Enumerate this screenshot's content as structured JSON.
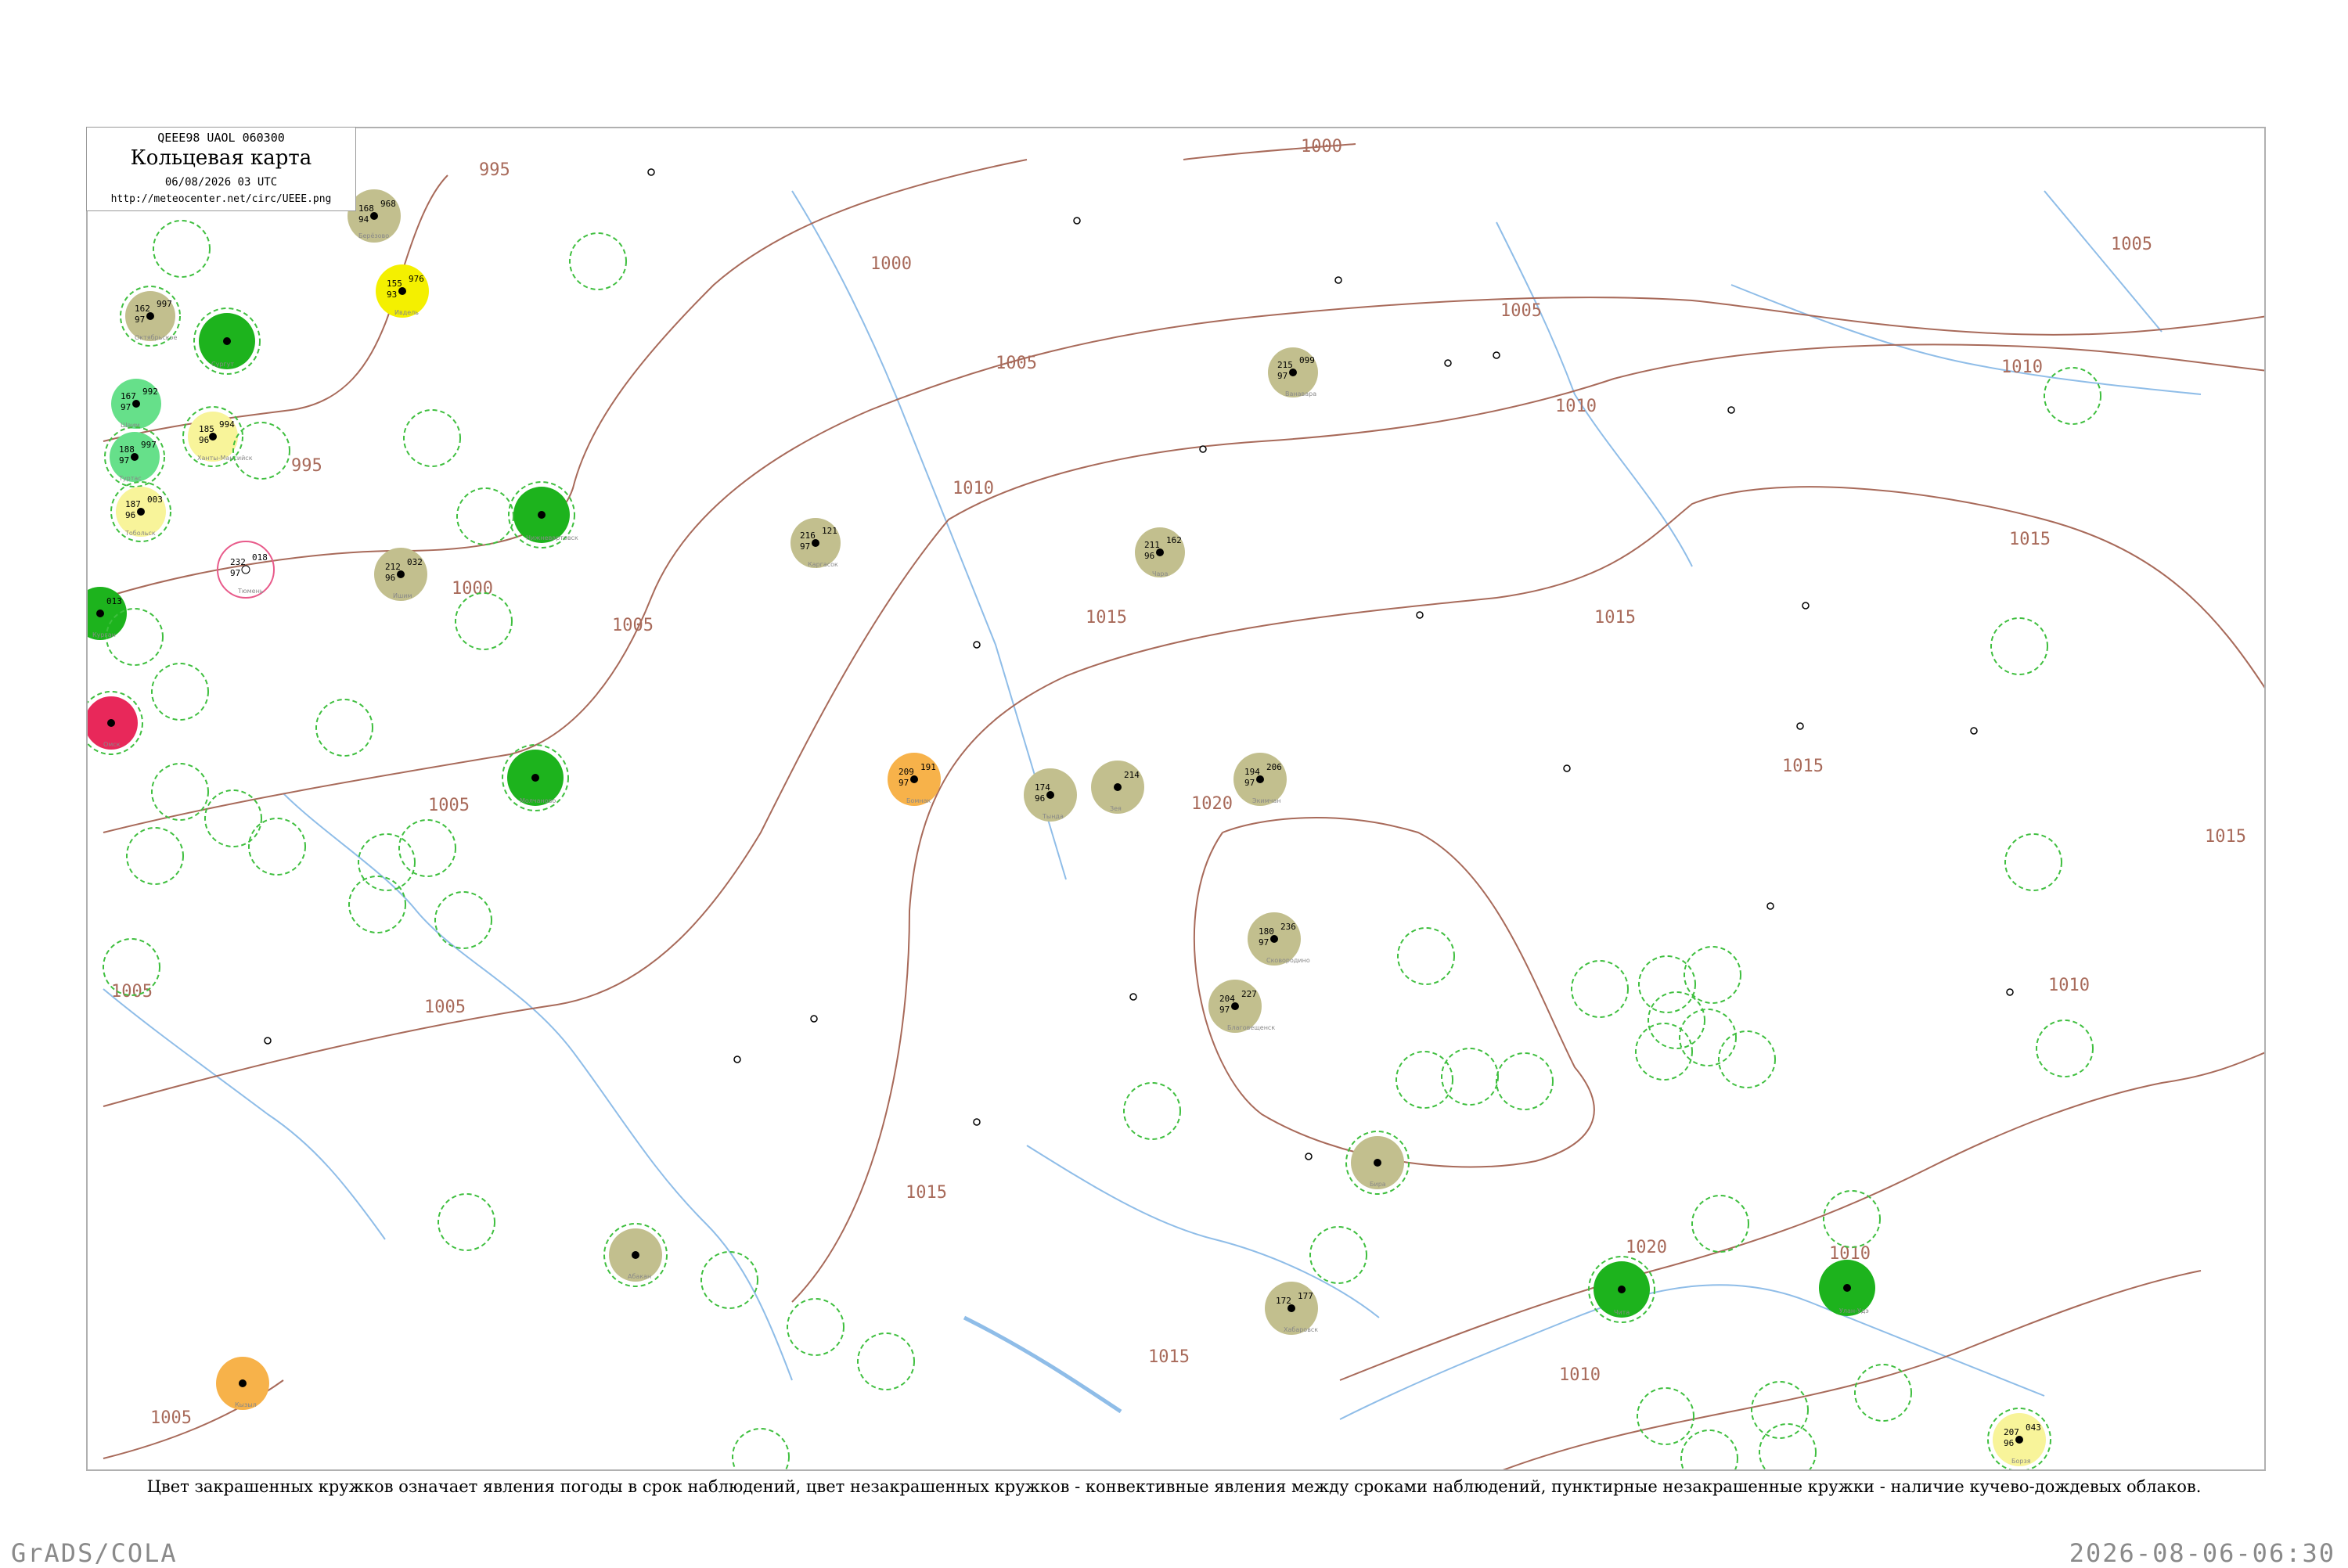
{
  "header": {
    "code": "QEEE98  UAOL  060300",
    "title": "Кольцевая карта",
    "date": "06/08/2026 03 UTC",
    "url": "http://meteocenter.net/circ/UEEE.png"
  },
  "caption": "Цвет закрашенных кружков означает явления погоды в срок наблюдений, цвет незакрашенных кружков - конвективные явления между сроками наблюдений, пунктирные незакрашенные кружки - наличие кучево-дождевых облаков.",
  "footer": {
    "left": "GrADS/COLA",
    "right": "2026-08-06-06:30"
  },
  "colors": {
    "isobar": "#a86a5a",
    "river": "#8fbde8",
    "cb_dashed": "#3fbf3f",
    "fill_olive": "#c2bf8e",
    "fill_green": "#1db31d",
    "fill_lightgreen": "#66e08a",
    "fill_yellow": "#f4f000",
    "fill_paleyellow": "#f8f49a",
    "fill_orange": "#f7b24a",
    "fill_red": "#e8285a",
    "ring_pink": "#e85a8a"
  },
  "isobar_labels": [
    {
      "text": "995"
    },
    {
      "text": "995"
    },
    {
      "text": "1000"
    },
    {
      "text": "1000"
    },
    {
      "text": "1000"
    },
    {
      "text": "1005"
    },
    {
      "text": "1005"
    },
    {
      "text": "1005"
    },
    {
      "text": "1005"
    },
    {
      "text": "1005"
    },
    {
      "text": "1005"
    },
    {
      "text": "1005"
    },
    {
      "text": "1005"
    },
    {
      "text": "1010"
    },
    {
      "text": "1010"
    },
    {
      "text": "1010"
    },
    {
      "text": "1010"
    },
    {
      "text": "1010"
    },
    {
      "text": "1010"
    },
    {
      "text": "1015"
    },
    {
      "text": "1015"
    },
    {
      "text": "1015"
    },
    {
      "text": "1015"
    },
    {
      "text": "1015"
    },
    {
      "text": "1015"
    },
    {
      "text": "1015"
    },
    {
      "text": "1020"
    },
    {
      "text": "1020"
    }
  ],
  "stations": [
    {
      "name": "Ханты-Мансийск",
      "t": "185",
      "p": "994",
      "td": "96",
      "fill": "paleyellow",
      "cb": true
    },
    {
      "name": "Берёзово",
      "t": "168",
      "p": "968",
      "td": "94",
      "fill": "olive",
      "cb": false
    },
    {
      "name": "Ивдель",
      "t": "155",
      "p": "976",
      "td": "93",
      "fill": "yellow",
      "cb": false
    },
    {
      "name": "Октябрьское",
      "t": "162",
      "p": "997",
      "td": "97",
      "fill": "olive",
      "cb": true
    },
    {
      "name": "Шаим",
      "t": "167",
      "p": "992",
      "td": "97",
      "fill": "lightgreen",
      "cb": false
    },
    {
      "name": "Туртас",
      "t": "188",
      "p": "997",
      "td": "97",
      "fill": "lightgreen",
      "cb": true
    },
    {
      "name": "Тобольск",
      "t": "187",
      "p": "003",
      "td": "96",
      "fill": "paleyellow",
      "cb": true
    },
    {
      "name": "Тюмень",
      "t": "232",
      "p": "018",
      "td": "97",
      "fill": "none",
      "ring": "pink",
      "cb": false
    },
    {
      "name": "Ишим",
      "t": "212",
      "p": "032",
      "td": "96",
      "fill": "olive",
      "cb": false
    },
    {
      "name": "Курган",
      "t": "",
      "p": "013",
      "td": "",
      "fill": "green",
      "cb": false
    },
    {
      "name": "Омск",
      "t": "",
      "p": "",
      "td": "",
      "fill": "red",
      "cb": true
    },
    {
      "name": "Сургут",
      "t": "",
      "p": "",
      "td": "",
      "fill": "green",
      "cb": true
    },
    {
      "name": "Нижневартовск",
      "t": "",
      "p": "",
      "td": "",
      "fill": "green",
      "cb": true
    },
    {
      "name": "Молчаново",
      "t": "",
      "p": "",
      "td": "",
      "fill": "green",
      "cb": true
    },
    {
      "name": "Каргасок",
      "t": "216",
      "p": "121",
      "td": "97",
      "fill": "olive",
      "cb": false
    },
    {
      "name": "Ванавара",
      "t": "215",
      "p": "099",
      "td": "97",
      "fill": "olive",
      "cb": false
    },
    {
      "name": "Чара",
      "t": "211",
      "p": "162",
      "td": "96",
      "fill": "olive",
      "cb": false
    },
    {
      "name": "Бомнак",
      "t": "209",
      "p": "191",
      "td": "97",
      "fill": "orange",
      "cb": false
    },
    {
      "name": "Тында",
      "t": "174",
      "p": "",
      "td": "96",
      "fill": "olive",
      "cb": false
    },
    {
      "name": "Зея",
      "t": "",
      "p": "214",
      "td": "96",
      "fill": "olive",
      "cb": false
    },
    {
      "name": "Экимчан",
      "t": "194",
      "p": "206",
      "td": "97",
      "fill": "olive",
      "cb": false
    },
    {
      "name": "Сковородино",
      "t": "180",
      "p": "236",
      "td": "97",
      "fill": "olive",
      "cb": false
    },
    {
      "name": "Благовещенск",
      "t": "204",
      "p": "227",
      "td": "97",
      "fill": "olive",
      "cb": false
    },
    {
      "name": "Бира",
      "t": "",
      "p": "",
      "td": "",
      "fill": "olive",
      "cb": false
    },
    {
      "name": "Хабаровск",
      "t": "172",
      "p": "177",
      "td": "",
      "fill": "olive",
      "cb": false
    },
    {
      "name": "Абакан",
      "t": "",
      "p": "",
      "td": "",
      "fill": "olive",
      "cb": false
    },
    {
      "name": "Чита",
      "t": "",
      "p": "",
      "td": "",
      "fill": "green",
      "cb": true
    },
    {
      "name": "Улан-Удэ",
      "t": "",
      "p": "",
      "td": "",
      "fill": "green",
      "cb": true
    },
    {
      "name": "Кызыл",
      "t": "",
      "p": "",
      "td": "",
      "fill": "orange",
      "cb": false
    },
    {
      "name": "Борзя",
      "t": "207",
      "p": "043",
      "td": "96",
      "fill": "paleyellow",
      "cb": true
    }
  ]
}
